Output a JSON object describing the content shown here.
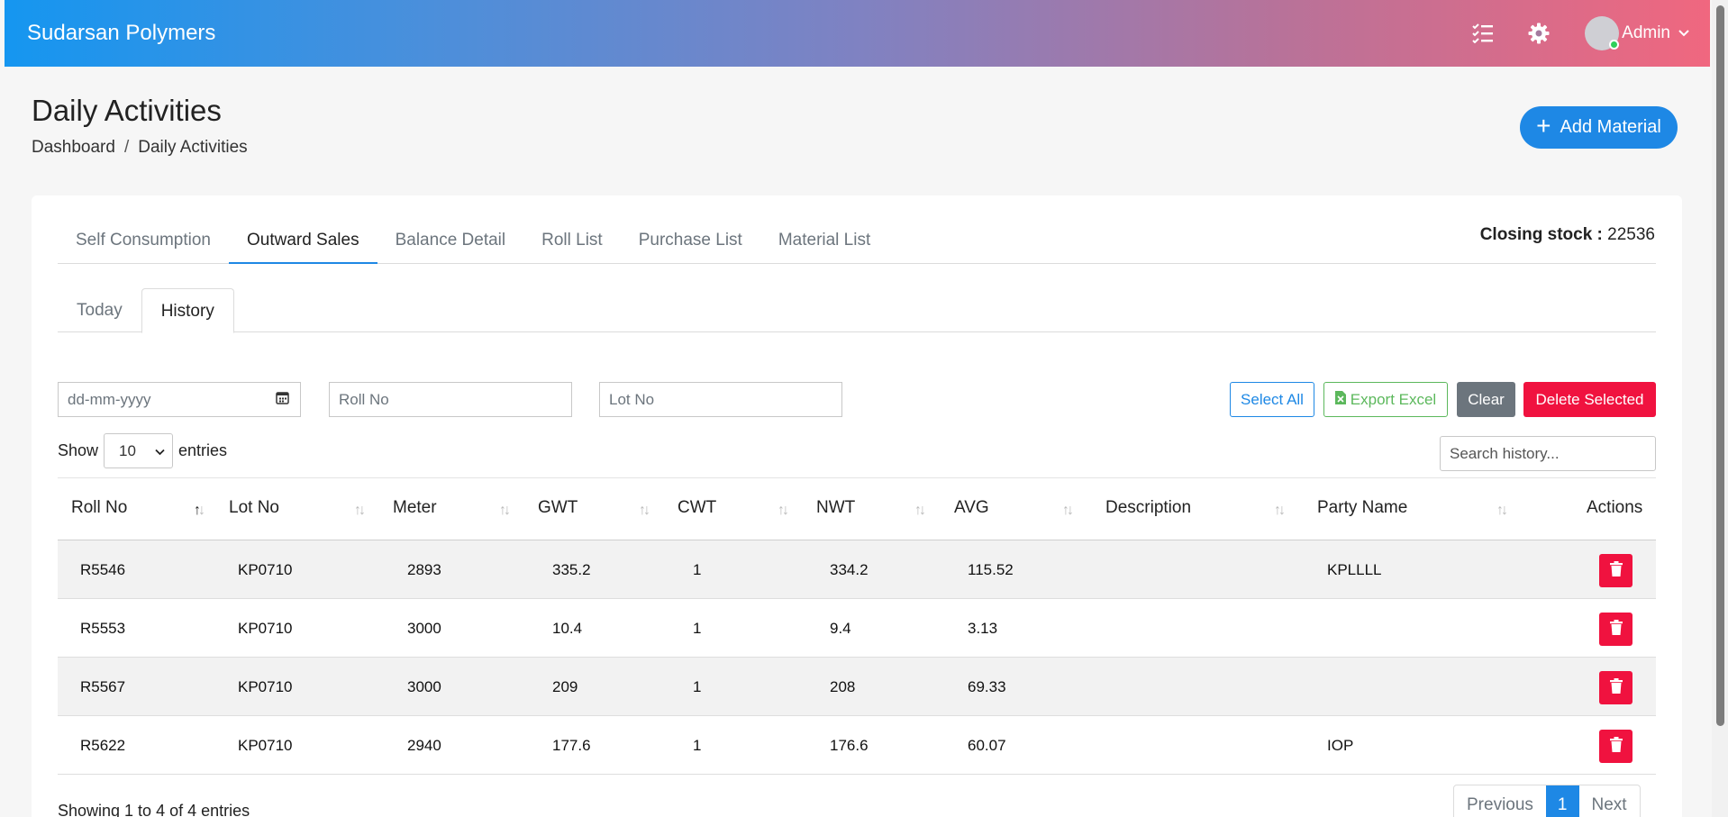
{
  "app": {
    "title": "Sudarsan Polymers",
    "user": "Admin"
  },
  "page": {
    "title": "Daily Activities",
    "breadcrumb": [
      "Dashboard",
      "/",
      "Daily Activities"
    ],
    "add_button": "Add Material"
  },
  "tabs": [
    "Self Consumption",
    "Outward Sales",
    "Balance Detail",
    "Roll List",
    "Purchase List",
    "Material List"
  ],
  "active_tab": "Outward Sales",
  "closing_stock": {
    "label": "Closing stock :",
    "value": "22536"
  },
  "subtabs": [
    "Today",
    "History"
  ],
  "filters": {
    "date_placeholder": "dd-mm-yyyy",
    "roll_placeholder": "Roll No",
    "lot_placeholder": "Lot No"
  },
  "buttons": {
    "select_all": "Select All",
    "export_excel": "Export Excel",
    "clear": "Clear",
    "delete_selected": "Delete Selected"
  },
  "length_menu": {
    "show": "Show",
    "value": "10",
    "entries": "entries"
  },
  "search_placeholder": "Search history...",
  "table": {
    "columns": [
      "Roll No",
      "Lot No",
      "Meter",
      "GWT",
      "CWT",
      "NWT",
      "AVG",
      "Description",
      "Party Name",
      "Actions"
    ],
    "rows": [
      [
        "R5546",
        "KP0710",
        "2893",
        "335.2",
        "1",
        "334.2",
        "115.52",
        "",
        "KPLLLL"
      ],
      [
        "R5553",
        "KP0710",
        "3000",
        "10.4",
        "1",
        "9.4",
        "3.13",
        "",
        ""
      ],
      [
        "R5567",
        "KP0710",
        "3000",
        "209",
        "1",
        "208",
        "69.33",
        "",
        ""
      ],
      [
        "R5622",
        "KP0710",
        "2940",
        "177.6",
        "1",
        "176.6",
        "60.07",
        "",
        "IOP"
      ]
    ]
  },
  "footer": {
    "info": "Showing 1 to 4 of 4 entries",
    "previous": "Previous",
    "page": "1",
    "next": "Next"
  },
  "colors": {
    "primary": "#1e88e5",
    "danger": "#f0123f",
    "success": "#5cb85c",
    "secondary": "#6c757d"
  }
}
